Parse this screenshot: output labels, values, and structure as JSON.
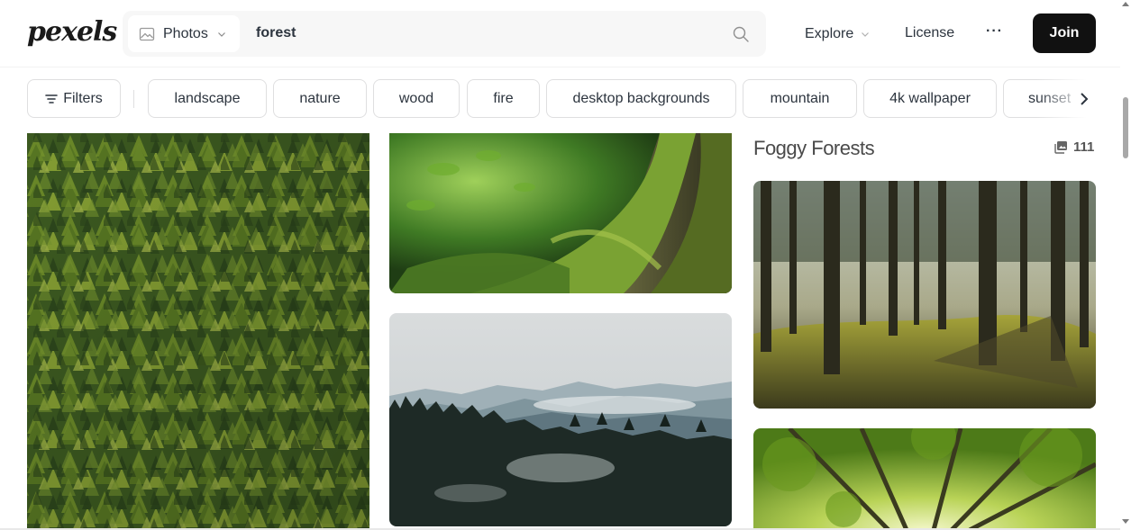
{
  "header": {
    "logo": "pexels",
    "search": {
      "type_label": "Photos",
      "query": "forest"
    },
    "nav": {
      "explore": "Explore",
      "license": "License",
      "more": "···",
      "join": "Join"
    }
  },
  "tagbar": {
    "filters_label": "Filters",
    "tags": [
      {
        "label": "landscape"
      },
      {
        "label": "nature"
      },
      {
        "label": "wood"
      },
      {
        "label": "fire"
      },
      {
        "label": "desktop backgrounds"
      },
      {
        "label": "mountain"
      },
      {
        "label": "4k wallpaper"
      },
      {
        "label": "sunset"
      }
    ]
  },
  "collection": {
    "title": "Foggy Forests",
    "count": "111"
  },
  "colors": {
    "accent": "#111111",
    "text": "#2c343e",
    "border": "#dfdfe0",
    "search_bg": "#f7f7f7"
  },
  "icons": {
    "type_select": "image-icon",
    "search": "search-icon",
    "filters": "filter-lines-icon",
    "collection_count": "photo-stack-icon",
    "tag_next": "chevron-right-icon"
  }
}
